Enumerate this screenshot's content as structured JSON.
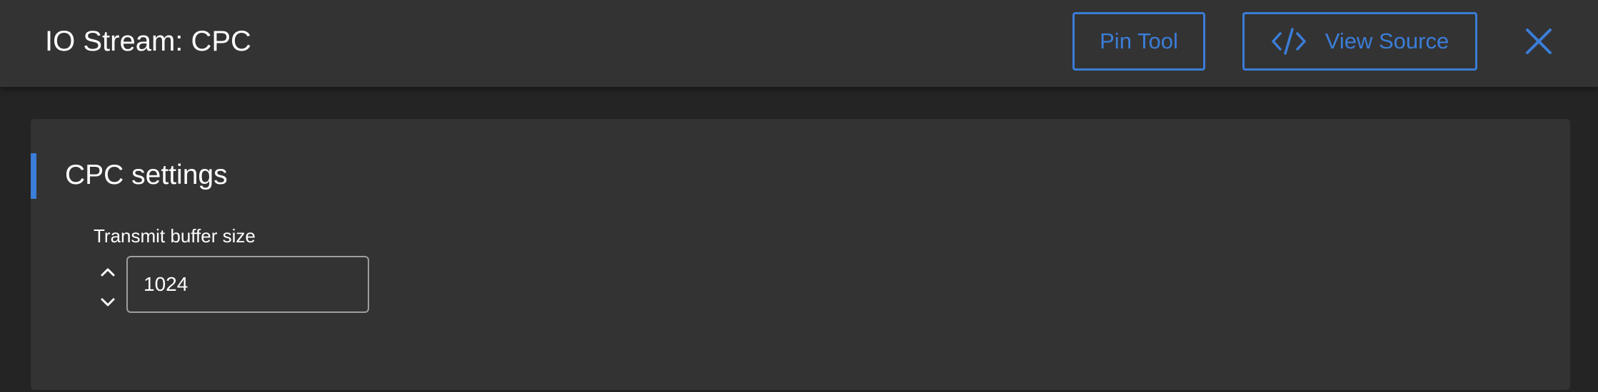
{
  "header": {
    "title": "IO Stream: CPC",
    "pin_tool_label": "Pin Tool",
    "view_source_label": "View Source",
    "close_icon": "close-icon",
    "view_source_icon": "code-icon"
  },
  "settings": {
    "section_title": "CPC settings",
    "transmit_buffer": {
      "label": "Transmit buffer size",
      "value": "1024",
      "increment_icon": "chevron-up-icon",
      "decrement_icon": "chevron-down-icon"
    }
  },
  "colors": {
    "accent": "#3b7dd8",
    "header_bg": "#333333",
    "page_bg": "#242424",
    "panel_bg": "#333333",
    "input_border": "#9e9e9e"
  }
}
